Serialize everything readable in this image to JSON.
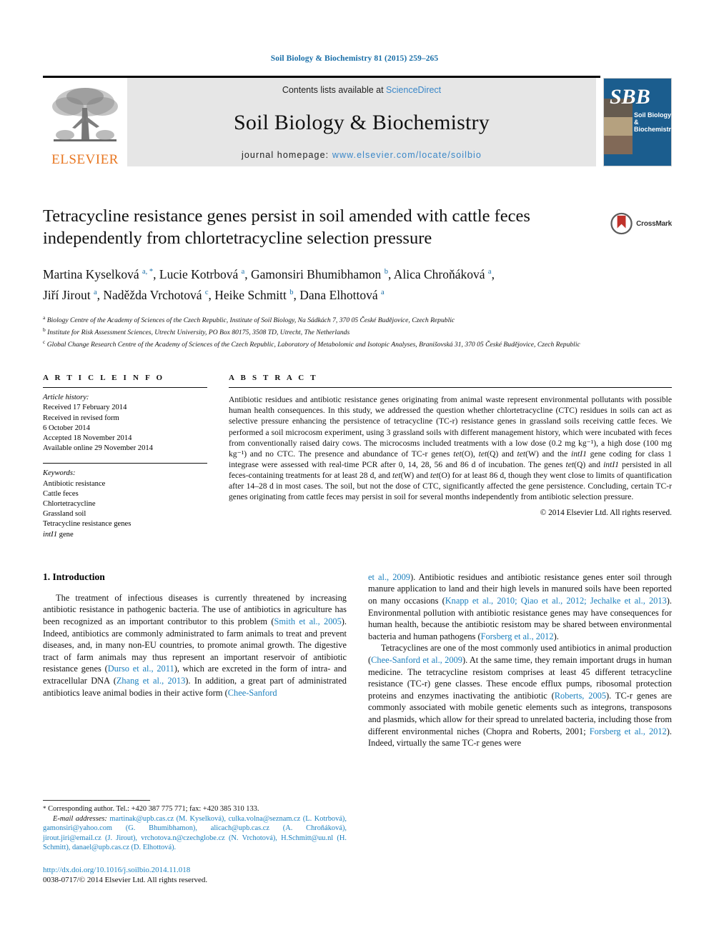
{
  "running_head": "Soil Biology & Biochemistry 81 (2015) 259–265",
  "masthead": {
    "publisher_name": "ELSEVIER",
    "contents_prefix": "Contents lists available at ",
    "contents_link": "ScienceDirect",
    "journal_title": "Soil Biology & Biochemistry",
    "homepage_prefix": "journal homepage: ",
    "homepage_url": "www.elsevier.com/locate/soilbio",
    "cover_initials": "SBB",
    "cover_name_line1": "Soil Biology &",
    "cover_name_line2": "Biochemistry"
  },
  "article": {
    "title": "Tetracycline resistance genes persist in soil amended with cattle feces independently from chlortetracycline selection pressure",
    "crossmark_label": "CrossMark",
    "authors_line1": "Martina Kyselková a, *, Lucie Kotrbová a, Gamonsiri Bhumibhamon b, Alica Chroňáková a,",
    "authors_line2": "Jiří Jirout a, Naděžda Vrchotová c, Heike Schmitt b, Dana Elhottová a",
    "affiliations": [
      {
        "mark": "a",
        "text": "Biology Centre of the Academy of Sciences of the Czech Republic, Institute of Soil Biology, Na Sádkách 7, 370 05 České Budějovice, Czech Republic"
      },
      {
        "mark": "b",
        "text": "Institute for Risk Assessment Sciences, Utrecht University, PO Box 80175, 3508 TD, Utrecht, The Netherlands"
      },
      {
        "mark": "c",
        "text": "Global Change Research Centre of the Academy of Sciences of the Czech Republic, Laboratory of Metabolomic and Isotopic Analyses, Branišovská 31, 370 05 České Budějovice, Czech Republic"
      }
    ]
  },
  "article_info": {
    "heading": "A R T I C L E   I N F O",
    "history_label": "Article history:",
    "history": [
      "Received 17 February 2014",
      "Received in revised form",
      "6 October 2014",
      "Accepted 18 November 2014",
      "Available online 29 November 2014"
    ],
    "keywords_label": "Keywords:",
    "keywords": [
      "Antibiotic resistance",
      "Cattle feces",
      "Chlortetracycline",
      "Grassland soil",
      "Tetracycline resistance genes",
      "intI1 gene"
    ]
  },
  "abstract": {
    "heading": "A B S T R A C T",
    "text": "Antibiotic residues and antibiotic resistance genes originating from animal waste represent environmental pollutants with possible human health consequences. In this study, we addressed the question whether chlortetracycline (CTC) residues in soils can act as selective pressure enhancing the persistence of tetracycline (TC-r) resistance genes in grassland soils receiving cattle feces. We performed a soil microcosm experiment, using 3 grassland soils with different management history, which were incubated with feces from conventionally raised dairy cows. The microcosms included treatments with a low dose (0.2 mg kg⁻¹), a high dose (100 mg kg⁻¹) and no CTC. The presence and abundance of TC-r genes tet(O), tet(Q) and tet(W) and the intI1 gene coding for class 1 integrase were assessed with real-time PCR after 0, 14, 28, 56 and 86 d of incubation. The genes tet(Q) and intI1 persisted in all feces-containing treatments for at least 28 d, and tet(W) and tet(O) for at least 86 d, though they went close to limits of quantification after 14–28 d in most cases. The soil, but not the dose of CTC, significantly affected the gene persistence. Concluding, certain TC-r genes originating from cattle feces may persist in soil for several months independently from antibiotic selection pressure.",
    "copyright": "© 2014 Elsevier Ltd. All rights reserved."
  },
  "introduction": {
    "heading": "1. Introduction",
    "left_paragraph": "The treatment of infectious diseases is currently threatened by increasing antibiotic resistance in pathogenic bacteria. The use of antibiotics in agriculture has been recognized as an important contributor to this problem (Smith et al., 2005). Indeed, antibiotics are commonly administrated to farm animals to treat and prevent diseases, and, in many non-EU countries, to promote animal growth. The digestive tract of farm animals may thus represent an important reservoir of antibiotic resistance genes (Durso et al., 2011), which are excreted in the form of intra- and extracellular DNA (Zhang et al., 2013). In addition, a great part of administrated antibiotics leave animal bodies in their active form (Chee-Sanford",
    "right_paragraph_1": "et al., 2009). Antibiotic residues and antibiotic resistance genes enter soil through manure application to land and their high levels in manured soils have been reported on many occasions (Knapp et al., 2010; Qiao et al., 2012; Jechalke et al., 2013). Environmental pollution with antibiotic resistance genes may have consequences for human health, because the antibiotic resistom may be shared between environmental bacteria and human pathogens (Forsberg et al., 2012).",
    "right_paragraph_2": "Tetracyclines are one of the most commonly used antibiotics in animal production (Chee-Sanford et al., 2009). At the same time, they remain important drugs in human medicine. The tetracycline resistom comprises at least 45 different tetracycline resistance (TC-r) gene classes. These encode efflux pumps, ribosomal protection proteins and enzymes inactivating the antibiotic (Roberts, 2005). TC-r genes are commonly associated with mobile genetic elements such as integrons, transposons and plasmids, which allow for their spread to unrelated bacteria, including those from different environmental niches (Chopra and Roberts, 2001; Forsberg et al., 2012). Indeed, virtually the same TC-r genes were"
  },
  "footnotes": {
    "corresponding": "Corresponding author. Tel.: +420 387 775 771; fax: +420 385 310 133.",
    "email_label": "E-mail addresses:",
    "emails": "martinak@upb.cas.cz (M. Kyselková), culka.volna@seznam.cz (L. Kotrbová), gamonsiri@yahoo.com (G. Bhumibhamon), alicach@upb.cas.cz (A. Chroňáková), jirout.jiri@email.cz (J. Jirout), vrchotova.n@czechglobe.cz (N. Vrchotová), H.Schmitt@uu.nl (H. Schmitt), danael@upb.cas.cz (D. Elhottová).",
    "doi": "http://dx.doi.org/10.1016/j.soilbio.2014.11.018",
    "issn": "0038-0717/© 2014 Elsevier Ltd. All rights reserved."
  },
  "colors": {
    "link_blue": "#1a7fbd",
    "head_blue": "#1a6fa8",
    "elsevier_orange": "#E87722",
    "cover_blue": "#1b5d8e",
    "band_gray": "#e6e6e6",
    "crossmark_red": "#c0322b"
  }
}
